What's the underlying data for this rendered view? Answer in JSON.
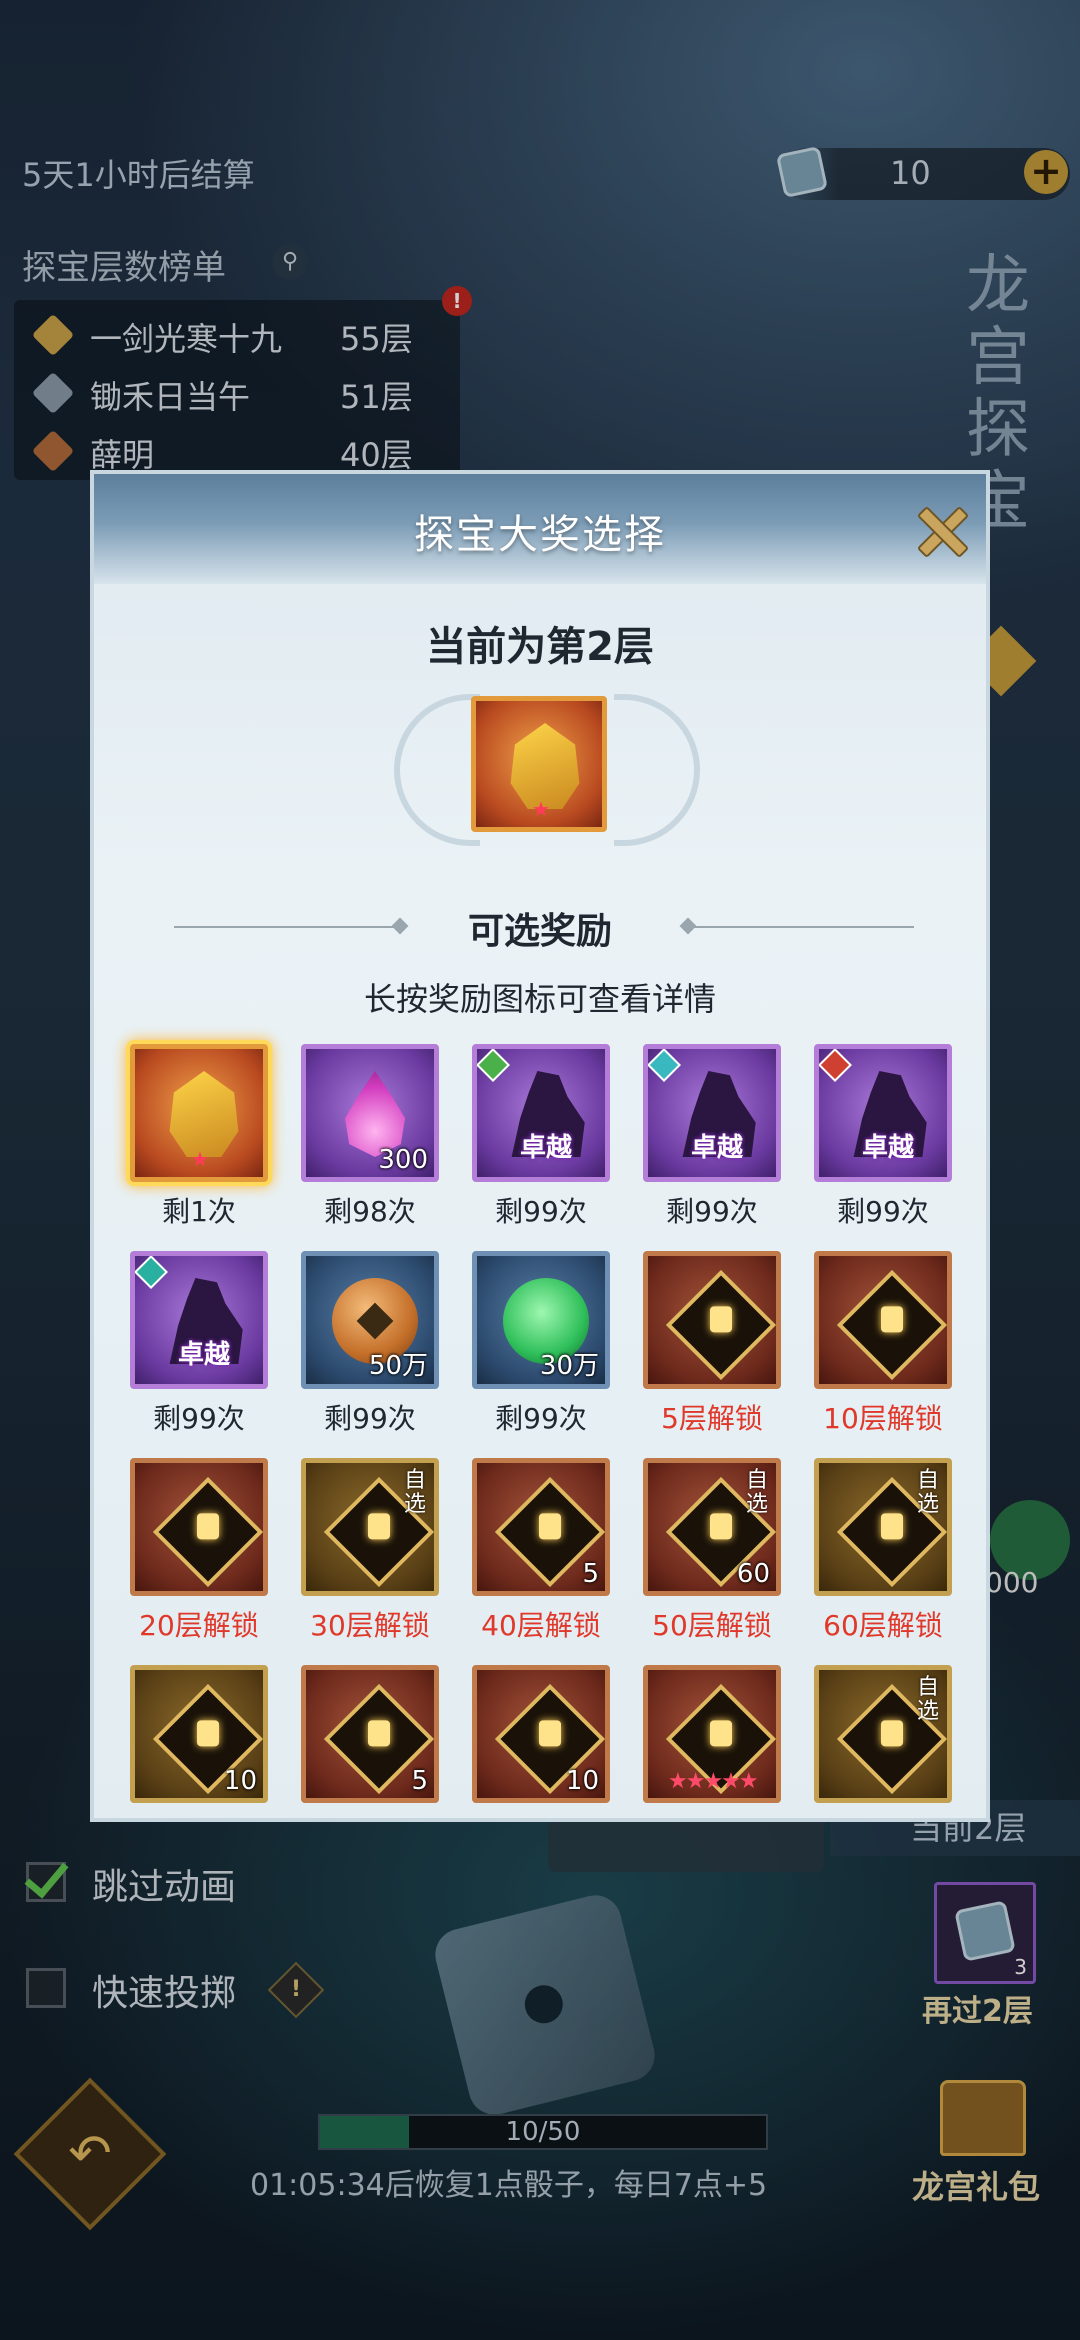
{
  "hud": {
    "countdown": "5天1小时后结算",
    "dice_count": "10",
    "add_symbol": "+",
    "leaderboard_title": "探宝层数榜单",
    "leaderboard": [
      {
        "name": "一剑光寒十九",
        "layers": "55层",
        "color": "#c9a048"
      },
      {
        "name": "锄禾日当午",
        "layers": "51层",
        "color": "#8a9aa8"
      },
      {
        "name": "薛明",
        "layers": "40层",
        "color": "#b06a3a"
      }
    ],
    "side_title": "龙宫探宝",
    "side_amount": "000",
    "current_floor": "当前2层",
    "skip_animation": "跳过动画",
    "quick_roll": "快速投掷",
    "reroll_count": "3",
    "reroll_label": "再过2层",
    "progress_text": "10/50",
    "progress_fraction": 0.2,
    "recover_text": "01:05:34后恢复1点骰子，每日7点+5",
    "gift_label": "龙宫礼包"
  },
  "modal": {
    "title": "探宝大奖选择",
    "floor_text": "当前为第2层",
    "section_title": "可选奖励",
    "hint": "长按奖励图标可查看详情",
    "rewards": [
      {
        "caption": "剩1次",
        "locked": false,
        "frame": "orange",
        "art": "helmet",
        "qty": "",
        "tag": "",
        "corner": "",
        "selected": true
      },
      {
        "caption": "剩98次",
        "locked": false,
        "frame": "purple",
        "art": "flame",
        "qty": "300",
        "tag": "",
        "corner": ""
      },
      {
        "caption": "剩99次",
        "locked": false,
        "frame": "purple",
        "art": "silhouette",
        "qty": "",
        "tag": "卓越",
        "corner": "",
        "gem": "#4ab04a"
      },
      {
        "caption": "剩99次",
        "locked": false,
        "frame": "purple",
        "art": "silhouette",
        "qty": "",
        "tag": "卓越",
        "corner": "",
        "gem": "#3ab8c0"
      },
      {
        "caption": "剩99次",
        "locked": false,
        "frame": "purple",
        "art": "silhouette",
        "qty": "",
        "tag": "卓越",
        "corner": "",
        "gem": "#d04030"
      },
      {
        "caption": "剩99次",
        "locked": false,
        "frame": "purple",
        "art": "silhouette",
        "qty": "",
        "tag": "卓越",
        "corner": "",
        "gem": "#2ab0a0"
      },
      {
        "caption": "剩99次",
        "locked": false,
        "frame": "blue",
        "art": "coin",
        "qty": "50万",
        "tag": "",
        "corner": ""
      },
      {
        "caption": "剩99次",
        "locked": false,
        "frame": "blue",
        "art": "jade",
        "qty": "30万",
        "tag": "",
        "corner": ""
      },
      {
        "caption": "5层解锁",
        "locked": true,
        "frame": "red",
        "art": "lock",
        "qty": "",
        "tag": "",
        "corner": ""
      },
      {
        "caption": "10层解锁",
        "locked": true,
        "frame": "red",
        "art": "lock",
        "qty": "",
        "tag": "",
        "corner": ""
      },
      {
        "caption": "20层解锁",
        "locked": true,
        "frame": "red",
        "art": "lock",
        "qty": "",
        "tag": "",
        "corner": ""
      },
      {
        "caption": "30层解锁",
        "locked": true,
        "frame": "gold",
        "art": "lock",
        "qty": "",
        "tag": "",
        "corner": "自选"
      },
      {
        "caption": "40层解锁",
        "locked": true,
        "frame": "red",
        "art": "lock",
        "qty": "5",
        "tag": "",
        "corner": ""
      },
      {
        "caption": "50层解锁",
        "locked": true,
        "frame": "red",
        "art": "lock",
        "qty": "60",
        "tag": "",
        "corner": "自选"
      },
      {
        "caption": "60层解锁",
        "locked": true,
        "frame": "gold",
        "art": "lock",
        "qty": "",
        "tag": "",
        "corner": "自选"
      },
      {
        "caption": "",
        "locked": true,
        "frame": "gold",
        "art": "lock",
        "qty": "10",
        "tag": "",
        "corner": ""
      },
      {
        "caption": "",
        "locked": true,
        "frame": "red",
        "art": "lock",
        "qty": "5",
        "tag": "",
        "corner": ""
      },
      {
        "caption": "",
        "locked": true,
        "frame": "red",
        "art": "lock",
        "qty": "10",
        "tag": "",
        "corner": ""
      },
      {
        "caption": "",
        "locked": true,
        "frame": "red",
        "art": "lock",
        "qty": "",
        "tag": "",
        "corner": "",
        "stars": "★★★★★"
      },
      {
        "caption": "",
        "locked": true,
        "frame": "gold",
        "art": "lock",
        "qty": "",
        "tag": "",
        "corner": "自选"
      }
    ]
  }
}
